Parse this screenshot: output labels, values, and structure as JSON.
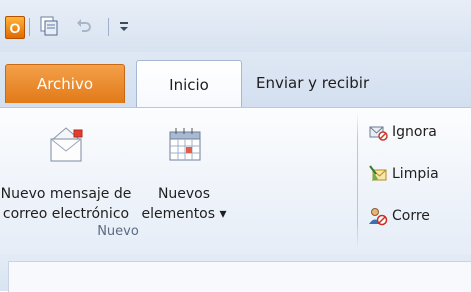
{
  "quick_access": {
    "app_logo": "O",
    "icons": [
      "outlook-logo-icon",
      "send-receive-icon",
      "undo-icon",
      "customize-qat-icon"
    ]
  },
  "tabs": [
    {
      "label": "Archivo"
    },
    {
      "label": "Inicio",
      "selected": true
    },
    {
      "label": "Enviar y recibir"
    }
  ],
  "ribbon": {
    "new_group": {
      "label": "Nuevo",
      "new_email": {
        "line1": "Nuevo mensaje de",
        "line2": "correo electrónico"
      },
      "new_items": {
        "line1": "Nuevos",
        "line2": "elementos ▾"
      }
    },
    "delete_group": {
      "ignore": "Ignora",
      "clean_up": "Limpia",
      "junk": "Corre"
    }
  },
  "colors": {
    "file_tab": "#e27a18",
    "ribbon_bg": "#eef3fa",
    "tab_strip": "#d3dff0"
  }
}
